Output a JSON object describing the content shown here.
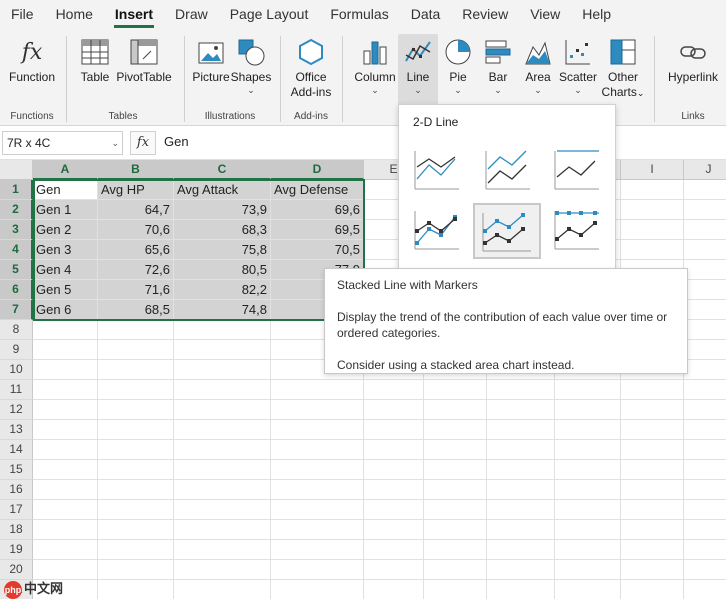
{
  "menu": {
    "tabs": [
      "File",
      "Home",
      "Insert",
      "Draw",
      "Page Layout",
      "Formulas",
      "Data",
      "Review",
      "View",
      "Help"
    ],
    "active": "Insert"
  },
  "ribbon": {
    "function_label": "Function",
    "functions_group": "Functions",
    "table_label": "Table",
    "pivot_label": "PivotTable",
    "tables_group": "Tables",
    "picture_label": "Picture",
    "shapes_label": "Shapes",
    "illustrations_group": "Illustrations",
    "office_label": "Office",
    "addins_label": "Add-ins",
    "addins_group": "Add-ins",
    "column_label": "Column",
    "line_label": "Line",
    "pie_label": "Pie",
    "bar_label": "Bar",
    "area_label": "Area",
    "scatter_label": "Scatter",
    "other_label": "Other",
    "charts_label": "Charts",
    "hyperlink_label": "Hyperlink",
    "links_group": "Links",
    "caret": "⌄"
  },
  "formula_bar": {
    "name_box": "7R x 4C",
    "fx": "fx",
    "value": "Gen"
  },
  "columns": [
    "A",
    "B",
    "C",
    "D",
    "E",
    "F",
    "G",
    "H",
    "I",
    "J"
  ],
  "rows": [
    "1",
    "2",
    "3",
    "4",
    "5",
    "6",
    "7",
    "8",
    "9",
    "10",
    "11",
    "12",
    "13",
    "14",
    "15",
    "16",
    "17",
    "18",
    "19",
    "20",
    "21"
  ],
  "table": [
    [
      "Gen",
      "Avg HP",
      "Avg Attack",
      "Avg Defense"
    ],
    [
      "Gen 1",
      "64,7",
      "73,9",
      "69,6"
    ],
    [
      "Gen 2",
      "70,6",
      "68,3",
      "69,5"
    ],
    [
      "Gen 3",
      "65,6",
      "75,8",
      "70,5"
    ],
    [
      "Gen 4",
      "72,6",
      "80,5",
      "77,9"
    ],
    [
      "Gen 5",
      "71,6",
      "82,2",
      ""
    ],
    [
      "Gen 6",
      "68,5",
      "74,8",
      ""
    ]
  ],
  "line_menu": {
    "title": "2-D Line",
    "items": [
      "Line",
      "Stacked Line",
      "100% Stacked Line",
      "Line with Markers",
      "Stacked Line with Markers",
      "100% Stacked Line with Markers"
    ]
  },
  "tooltip": {
    "title": "Stacked Line with Markers",
    "line1": "Display the trend of the contribution of each value over time or ordered categories.",
    "line2": "Consider using a stacked area chart instead."
  },
  "watermark": {
    "text": "中文网",
    "logo": "php"
  },
  "colors": {
    "accent": "#217346",
    "series1": "#2e8bc0",
    "series2": "#333333"
  }
}
